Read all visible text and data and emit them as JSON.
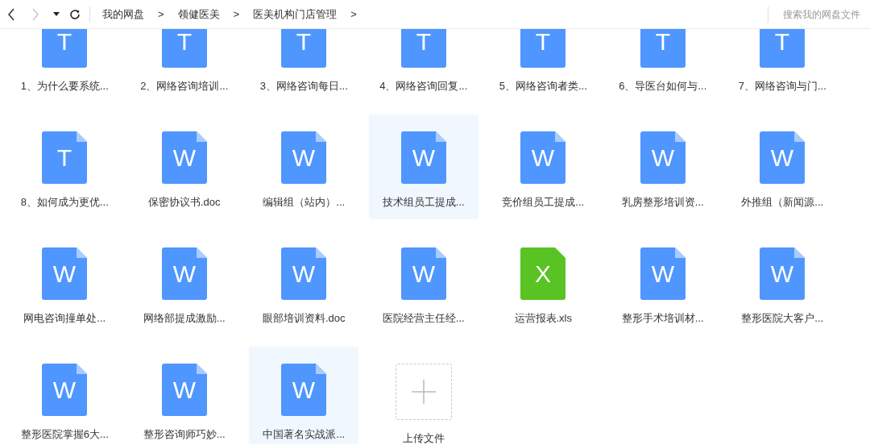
{
  "toolbar": {
    "back": {
      "disabled": false
    },
    "forward": {
      "disabled": true
    },
    "breadcrumbs": [
      "我的网盘",
      "领健医美",
      "医美机构门店管理"
    ],
    "separator": ">",
    "search": {
      "placeholder": "搜索我的网盘文件"
    }
  },
  "files": [
    {
      "kind": "txt",
      "letter": "T",
      "name": "1、为什么要系统...",
      "selected": false
    },
    {
      "kind": "txt",
      "letter": "T",
      "name": "2、网络咨询培训...",
      "selected": false
    },
    {
      "kind": "txt",
      "letter": "T",
      "name": "3、网络咨询每日...",
      "selected": false
    },
    {
      "kind": "txt",
      "letter": "T",
      "name": "4、网络咨询回复...",
      "selected": false
    },
    {
      "kind": "txt",
      "letter": "T",
      "name": "5、网络咨询者类...",
      "selected": false
    },
    {
      "kind": "txt",
      "letter": "T",
      "name": "6、导医台如何与...",
      "selected": false
    },
    {
      "kind": "txt",
      "letter": "T",
      "name": "7、网络咨询与门...",
      "selected": false
    },
    {
      "kind": "txt",
      "letter": "T",
      "name": "8、如何成为更优...",
      "selected": false
    },
    {
      "kind": "doc",
      "letter": "W",
      "name": "保密协议书.doc",
      "selected": false
    },
    {
      "kind": "doc",
      "letter": "W",
      "name": "编辑组（站内）...",
      "selected": false
    },
    {
      "kind": "doc",
      "letter": "W",
      "name": "技术组员工提成...",
      "selected": true
    },
    {
      "kind": "doc",
      "letter": "W",
      "name": "竞价组员工提成...",
      "selected": false
    },
    {
      "kind": "doc",
      "letter": "W",
      "name": "乳房整形培训资...",
      "selected": false
    },
    {
      "kind": "doc",
      "letter": "W",
      "name": "外推组（新闻源...",
      "selected": false
    },
    {
      "kind": "doc",
      "letter": "W",
      "name": "网电咨询撞单处...",
      "selected": false
    },
    {
      "kind": "doc",
      "letter": "W",
      "name": "网络部提成激励...",
      "selected": false
    },
    {
      "kind": "doc",
      "letter": "W",
      "name": "眼部培训资料.doc",
      "selected": false
    },
    {
      "kind": "doc",
      "letter": "W",
      "name": "医院经营主任经...",
      "selected": false
    },
    {
      "kind": "xls",
      "letter": "X",
      "name": "运营报表.xls",
      "selected": false
    },
    {
      "kind": "doc",
      "letter": "W",
      "name": "整形手术培训材...",
      "selected": false
    },
    {
      "kind": "doc",
      "letter": "W",
      "name": "整形医院大客户...",
      "selected": false
    },
    {
      "kind": "doc",
      "letter": "W",
      "name": "整形医院掌握6大...",
      "selected": false
    },
    {
      "kind": "doc",
      "letter": "W",
      "name": "整形咨询师巧妙...",
      "selected": false
    },
    {
      "kind": "doc",
      "letter": "W",
      "name": "中国著名实战派...",
      "selected": true
    },
    {
      "kind": "upload",
      "name": "上传文件",
      "selected": false
    }
  ]
}
